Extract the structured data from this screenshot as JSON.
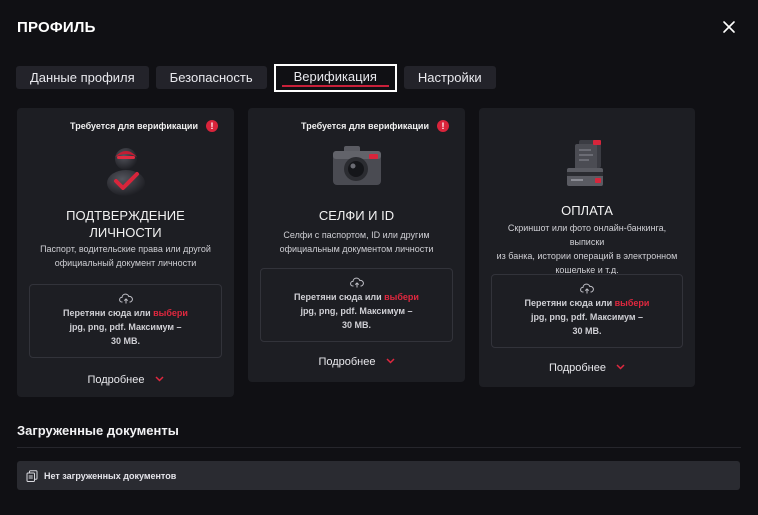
{
  "header": {
    "title": "ПРОФИЛЬ",
    "close_icon": "close-icon"
  },
  "tabs": [
    {
      "label": "Данные профиля",
      "active": false
    },
    {
      "label": "Безопасность",
      "active": false
    },
    {
      "label": "Верификация",
      "active": true
    },
    {
      "label": "Настройки",
      "active": false
    }
  ],
  "cards": [
    {
      "required": "Требуется для верификации",
      "title_line1": "ПОДТВЕРЖДЕНИЕ",
      "title_line2": "ЛИЧНОСТИ",
      "desc_line1": "Паспорт, водительские права или другой",
      "desc_line2": "официальный документ личности",
      "upload_text": "Перетяни сюда или",
      "upload_link": "выбери",
      "formats": "jpg, png, pdf. Максимум –",
      "size": "30 MB.",
      "more": "Подробнее"
    },
    {
      "required": "Требуется для верификации",
      "title_line1": "СЕЛФИ И ID",
      "desc_line1": "Селфи с паспортом, ID или другим",
      "desc_line2": "официальным документом личности",
      "upload_text": "Перетяни сюда или",
      "upload_link": "выбери",
      "formats": "jpg, png, pdf. Максимум –",
      "size": "30 MB.",
      "more": "Подробнее"
    },
    {
      "title_line1": "ОПЛАТА",
      "desc_line1": "Скриншот или фото онлайн-банкинга, выписки",
      "desc_line2": "из банка, истории операций в электронном",
      "desc_line3": "кошельке и т.д.",
      "upload_text": "Перетяни сюда или",
      "upload_link": "выбери",
      "formats": "jpg, png, pdf. Максимум –",
      "size": "30 MB.",
      "more": "Подробнее"
    }
  ],
  "uploaded": {
    "title": "Загруженные документы",
    "empty_text": "Нет загруженных документов"
  },
  "colors": {
    "accent": "#e0283f",
    "background": "#101014",
    "card": "#1d1e23"
  }
}
